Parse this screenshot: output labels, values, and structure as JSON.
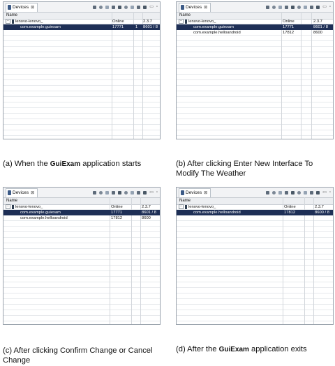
{
  "panels": [
    {
      "tab_title": "Devices",
      "tab_close": "⊠",
      "header": {
        "name": "Name"
      },
      "rows": [
        {
          "name": "lenovo-lenovo_",
          "status": "Online",
          "c3": "",
          "version": "2.3.7",
          "device": true,
          "selected": false
        },
        {
          "name": "com.example.guiexam",
          "status": "17771",
          "c3": "1",
          "version": "8601 / 8",
          "device": false,
          "selected": true
        }
      ],
      "caption": {
        "prefix": "(a) When the ",
        "app": "GuiExam",
        "suffix": " application starts"
      }
    },
    {
      "tab_title": "Devices",
      "tab_close": "⊠",
      "header": {
        "name": "Name"
      },
      "rows": [
        {
          "name": "lenovo-lenovo_",
          "status": "Online",
          "c3": "",
          "version": "2.3.7",
          "device": true,
          "selected": false
        },
        {
          "name": "com.example.guiexam",
          "status": "17771",
          "c3": "",
          "version": "8601 / 8",
          "device": false,
          "selected": true
        },
        {
          "name": "com.example.helloandroid",
          "status": "17812",
          "c3": "",
          "version": "8600",
          "device": false,
          "selected": false
        }
      ],
      "caption": {
        "text": "(b) After clicking Enter New Interface To Modify The Weather"
      }
    },
    {
      "tab_title": "Devices",
      "tab_close": "⊠",
      "header": {
        "name": "Name"
      },
      "rows": [
        {
          "name": "lenovo-lenovo_",
          "status": "Online",
          "c3": "",
          "version": "2.3.7",
          "device": true,
          "selected": false
        },
        {
          "name": "com.example.guiexam",
          "status": "17771",
          "c3": "",
          "version": "8601 / 8",
          "device": false,
          "selected": true
        },
        {
          "name": "com.example.helloandroid",
          "status": "17812",
          "c3": "",
          "version": "8600",
          "device": false,
          "selected": false
        }
      ],
      "caption": {
        "text": "(c) After clicking Confirm Change or Cancel Change"
      }
    },
    {
      "tab_title": "Devices",
      "tab_close": "⊠",
      "header": {
        "name": "Name"
      },
      "rows": [
        {
          "name": "lenovo-lenovo_",
          "status": "Online",
          "c3": "",
          "version": "2.3.7",
          "device": true,
          "selected": false
        },
        {
          "name": "com.example.helloandroid",
          "status": "17812",
          "c3": "",
          "version": "8600 / 8",
          "device": false,
          "selected": true
        }
      ],
      "caption": {
        "prefix": "(d) After the ",
        "app": "GuiExam",
        "suffix": " application exits"
      }
    }
  ],
  "window_controls": {
    "minimize": "▭",
    "maximize": "▫"
  }
}
